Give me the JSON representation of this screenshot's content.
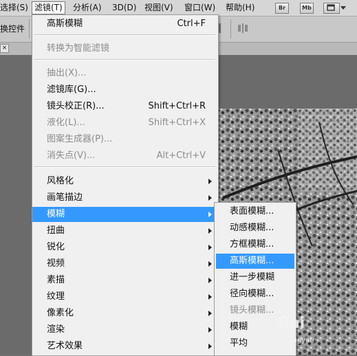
{
  "menubar": {
    "items": [
      "选择(S)",
      "滤镜(T)",
      "分析(A)",
      "3D(D)",
      "视图(V)",
      "窗口(W)",
      "帮助(H)"
    ],
    "buttons": [
      "Br",
      "Mb"
    ]
  },
  "toolbar": {
    "label": "换控件"
  },
  "filter_menu": {
    "items": [
      {
        "label": "高斯模糊",
        "shortcut": "Ctrl+F"
      },
      {
        "label": "转换为智能滤镜"
      },
      {
        "label": "抽出(X)..."
      },
      {
        "label": "滤镜库(G)..."
      },
      {
        "label": "镜头校正(R)...",
        "shortcut": "Shift+Ctrl+R"
      },
      {
        "label": "液化(L)...",
        "shortcut": "Shift+Ctrl+X"
      },
      {
        "label": "图案生成器(P)..."
      },
      {
        "label": "消失点(V)...",
        "shortcut": "Alt+Ctrl+V"
      },
      {
        "label": "风格化"
      },
      {
        "label": "画笔描边"
      },
      {
        "label": "模糊"
      },
      {
        "label": "扭曲"
      },
      {
        "label": "锐化"
      },
      {
        "label": "视频"
      },
      {
        "label": "素描"
      },
      {
        "label": "纹理"
      },
      {
        "label": "像素化"
      },
      {
        "label": "渲染"
      },
      {
        "label": "艺术效果"
      }
    ]
  },
  "blur_submenu": {
    "items": [
      "表面模糊...",
      "动感模糊...",
      "方框模糊...",
      "高斯模糊...",
      "进一步模糊",
      "径向模糊...",
      "镜头模糊...",
      "模糊",
      "平均"
    ]
  },
  "watermark": {
    "text": "Bai",
    "sub": "jingyan"
  },
  "colors": {
    "highlight": "#3399ff",
    "menu_bg": "#f0f0f0",
    "disabled": "#8c8c8c"
  }
}
